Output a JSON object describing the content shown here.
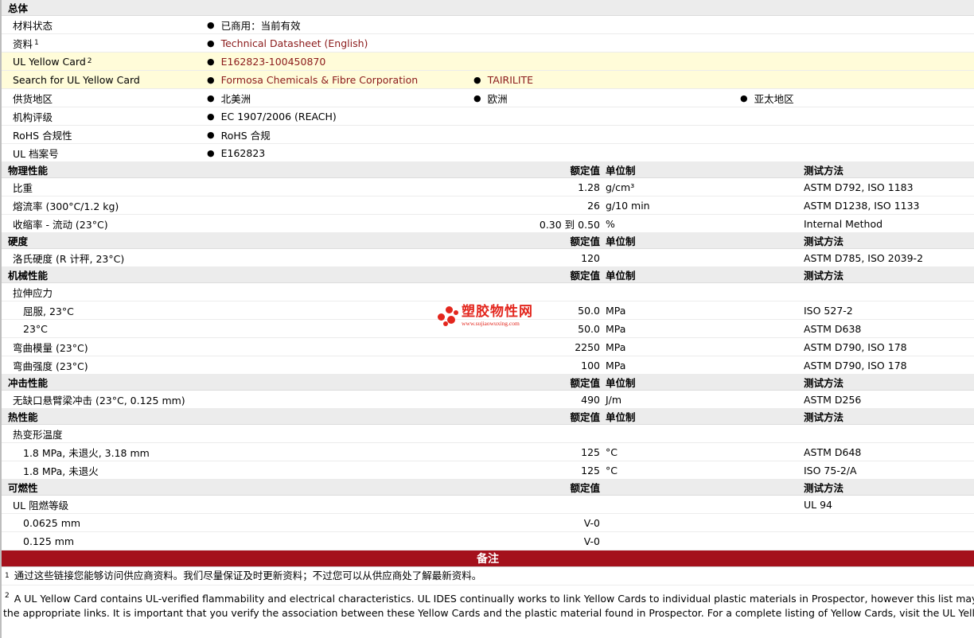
{
  "general": {
    "section_title": "总体",
    "rows": [
      {
        "label": "材料状态",
        "values": [
          "已商用：当前有效"
        ]
      },
      {
        "label": "资料",
        "sup": "1",
        "values": [
          "Technical Datasheet (English)"
        ],
        "link": true
      },
      {
        "label": "UL Yellow Card",
        "sup": "2",
        "values": [
          "E162823-100450870"
        ],
        "link": true,
        "yellow": true
      },
      {
        "label": "Search for UL Yellow Card",
        "values": [
          "Formosa Chemicals & Fibre Corporation",
          "TAIRILITE"
        ],
        "link": true,
        "yellow": true
      },
      {
        "label": "供货地区",
        "values": [
          "北美洲",
          "欧洲",
          "亚太地区"
        ]
      },
      {
        "label": "机构评级",
        "values": [
          "EC 1907/2006 (REACH)"
        ]
      },
      {
        "label": "RoHS 合规性",
        "values": [
          "RoHS 合规"
        ]
      },
      {
        "label": "UL 档案号",
        "values": [
          "E162823"
        ]
      }
    ]
  },
  "headers": {
    "nominal": "额定值",
    "unit": "单位制",
    "method": "测试方法"
  },
  "sections": [
    {
      "title": "物理性能",
      "show_unit": true,
      "rows": [
        {
          "label": "比重",
          "nominal": "1.28",
          "unit": "g/cm³",
          "method": "ASTM D792, ISO 1183"
        },
        {
          "label": "熔流率 (300°C/1.2 kg)",
          "nominal": "26",
          "unit": "g/10 min",
          "method": "ASTM D1238, ISO 1133"
        },
        {
          "label": "收缩率 - 流动 (23°C)",
          "nominal": "0.30 到  0.50",
          "unit": "%",
          "method": "Internal Method"
        }
      ]
    },
    {
      "title": "硬度",
      "show_unit": true,
      "rows": [
        {
          "label": "洛氏硬度 (R 计秤, 23°C)",
          "nominal": "120",
          "unit": "",
          "method": "ASTM D785, ISO 2039-2"
        }
      ]
    },
    {
      "title": "机械性能",
      "show_unit": true,
      "rows": [
        {
          "label": "拉伸应力",
          "nominal": "",
          "unit": "",
          "method": ""
        },
        {
          "label": "屈服, 23°C",
          "sub": true,
          "nominal": "50.0",
          "unit": "MPa",
          "method": "ISO 527-2"
        },
        {
          "label": "23°C",
          "sub": true,
          "nominal": "50.0",
          "unit": "MPa",
          "method": "ASTM D638"
        },
        {
          "label": "弯曲模量 (23°C)",
          "nominal": "2250",
          "unit": "MPa",
          "method": "ASTM D790, ISO 178"
        },
        {
          "label": "弯曲强度 (23°C)",
          "nominal": "100",
          "unit": "MPa",
          "method": "ASTM D790, ISO 178"
        }
      ]
    },
    {
      "title": "冲击性能",
      "show_unit": true,
      "rows": [
        {
          "label": "无缺口悬臂梁冲击 (23°C, 0.125 mm)",
          "nominal": "490",
          "unit": "J/m",
          "method": "ASTM D256"
        }
      ]
    },
    {
      "title": "热性能",
      "show_unit": true,
      "rows": [
        {
          "label": "热变形温度",
          "nominal": "",
          "unit": "",
          "method": ""
        },
        {
          "label": "1.8 MPa, 未退火, 3.18 mm",
          "sub": true,
          "nominal": "125",
          "unit": "°C",
          "method": "ASTM D648"
        },
        {
          "label": "1.8 MPa, 未退火",
          "sub": true,
          "nominal": "125",
          "unit": "°C",
          "method": "ISO 75-2/A"
        }
      ]
    },
    {
      "title": "可燃性",
      "show_unit": false,
      "rows": [
        {
          "label": "UL 阻燃等级",
          "nominal": "",
          "unit": "",
          "method": "UL 94"
        },
        {
          "label": "0.0625 mm",
          "sub": true,
          "nominal": "V-0",
          "unit": "",
          "method": ""
        },
        {
          "label": "0.125 mm",
          "sub": true,
          "nominal": "V-0",
          "unit": "",
          "method": ""
        }
      ]
    }
  ],
  "notes": {
    "title": "备注",
    "items": [
      {
        "num": "1",
        "text": "通过这些链接您能够访问供应商资料。我们尽量保证及时更新资料；不过您可以从供应商处了解最新资料。"
      },
      {
        "num": "2",
        "text": "A UL Yellow Card contains UL-verified flammability and electrical characteristics. UL IDES continually works to link Yellow Cards to individual plastic materials in Prospector, however this list may not include all of",
        "text2": "the appropriate links. It is important that you verify the association between these Yellow Cards and the plastic material found in Prospector. For a complete listing of Yellow Cards, visit the UL Yellow Card Search."
      }
    ]
  },
  "watermark": {
    "cn": "塑胶物性网",
    "url": "www.sujiaowuxing.com",
    "color": "#e3261d"
  },
  "colors": {
    "section_bg": "#ececec",
    "yellow_bg": "#fffcd9",
    "link": "#8b1a1a",
    "notes_bar": "#a4111c"
  }
}
